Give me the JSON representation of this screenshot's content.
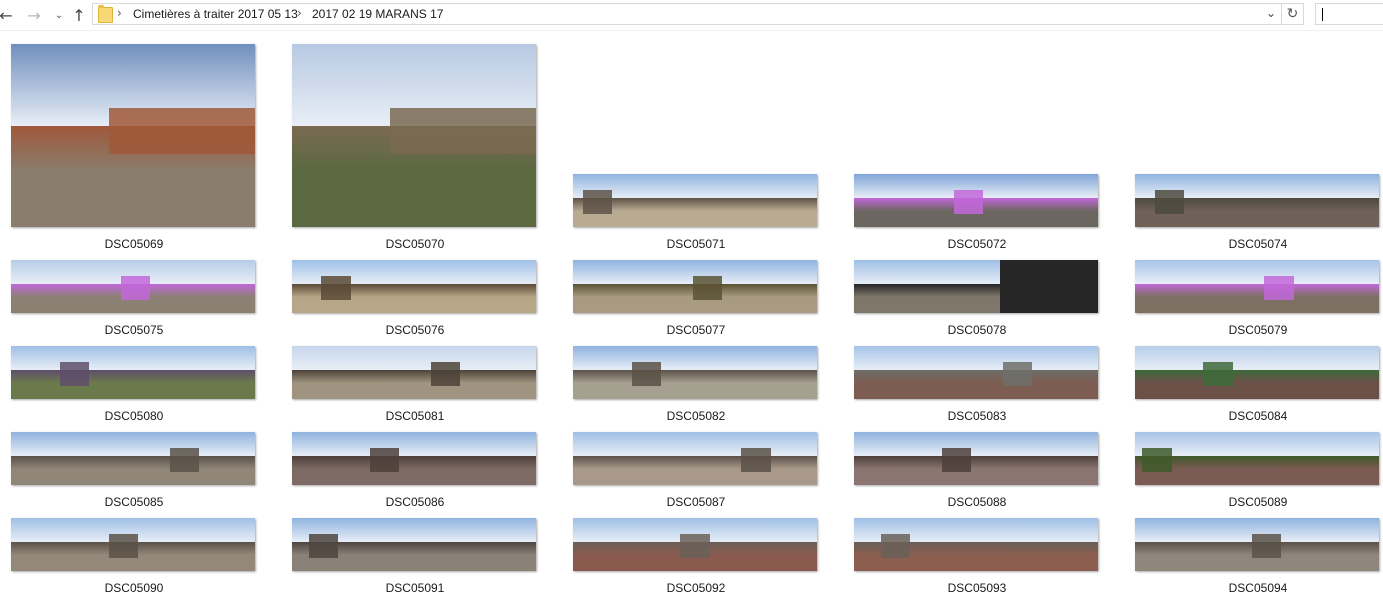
{
  "toolbar": {
    "back_icon": "arrow-left-icon",
    "forward_icon": "arrow-right-icon",
    "recent_icon": "chevron-down-icon",
    "up_icon": "arrow-up-icon",
    "refresh_icon": "refresh-icon",
    "search_value": ""
  },
  "breadcrumb": [
    "Cimetières à traiter 2017 05 13",
    "2017 02 19 MARANS 17"
  ],
  "files": [
    {
      "name": "DSC05069",
      "shape": "tall",
      "sky": "#6f8fbd",
      "ground": "#8a7d6e",
      "mark": "#a0583a"
    },
    {
      "name": "DSC05070",
      "shape": "tall",
      "sky": "#b7c9e2",
      "ground": "#5b6940",
      "mark": "#7a6a52"
    },
    {
      "name": "DSC05071",
      "shape": "pano",
      "sky": "#8fb3e0",
      "ground": "#b9aa92",
      "mark": "#5d5246"
    },
    {
      "name": "DSC05072",
      "shape": "pano",
      "sky": "#7fa6d8",
      "ground": "#6c6660",
      "mark": "#c267d9"
    },
    {
      "name": "DSC05074",
      "shape": "pano",
      "sky": "#8fb3e0",
      "ground": "#6f6158",
      "mark": "#4d4a3e"
    },
    {
      "name": "DSC05075",
      "shape": "pano",
      "sky": "#b7cde8",
      "ground": "#8a8173",
      "mark": "#c267d9"
    },
    {
      "name": "DSC05076",
      "shape": "pano",
      "sky": "#9fc0e8",
      "ground": "#b8a688",
      "mark": "#5a4a36"
    },
    {
      "name": "DSC05077",
      "shape": "pano",
      "sky": "#8fb3e0",
      "ground": "#a99a82",
      "mark": "#5b5234"
    },
    {
      "name": "DSC05078",
      "shape": "pano",
      "sky": "#9fbfe6",
      "ground": "#7f786a",
      "mark": "#262626"
    },
    {
      "name": "DSC05079",
      "shape": "pano",
      "sky": "#a7c4e8",
      "ground": "#7d7062",
      "mark": "#c267d9"
    },
    {
      "name": "DSC05080",
      "shape": "pano",
      "sky": "#9fbfe6",
      "ground": "#6b7a4a",
      "mark": "#5e4e6a"
    },
    {
      "name": "DSC05081",
      "shape": "pano",
      "sky": "#c6d6ec",
      "ground": "#a09480",
      "mark": "#4c4338"
    },
    {
      "name": "DSC05082",
      "shape": "pano",
      "sky": "#8fb3e0",
      "ground": "#a6a090",
      "mark": "#5a5148"
    },
    {
      "name": "DSC05083",
      "shape": "pano",
      "sky": "#a7c4e8",
      "ground": "#7d5c52",
      "mark": "#6e6e68"
    },
    {
      "name": "DSC05084",
      "shape": "pano",
      "sky": "#b7cde8",
      "ground": "#6b5048",
      "mark": "#3e6a3a"
    },
    {
      "name": "DSC05085",
      "shape": "pano",
      "sky": "#8fb3e0",
      "ground": "#8f8678",
      "mark": "#5a5148"
    },
    {
      "name": "DSC05086",
      "shape": "pano",
      "sky": "#8fb3e0",
      "ground": "#7e6a64",
      "mark": "#4d3f3a"
    },
    {
      "name": "DSC05087",
      "shape": "pano",
      "sky": "#9fbfe6",
      "ground": "#a9998a",
      "mark": "#5a5148"
    },
    {
      "name": "DSC05088",
      "shape": "pano",
      "sky": "#8fb3e0",
      "ground": "#8a7570",
      "mark": "#4d3f3a"
    },
    {
      "name": "DSC05089",
      "shape": "pano",
      "sky": "#a7c4e8",
      "ground": "#7a5a52",
      "mark": "#3f5a2a"
    },
    {
      "name": "DSC05090",
      "shape": "pano",
      "sky": "#9fbfe6",
      "ground": "#938879",
      "mark": "#5a5148"
    },
    {
      "name": "DSC05091",
      "shape": "pano",
      "sky": "#8fb3e0",
      "ground": "#8a8177",
      "mark": "#4d4540"
    },
    {
      "name": "DSC05092",
      "shape": "pano",
      "sky": "#9fbfe6",
      "ground": "#8b5a4e",
      "mark": "#6a6058"
    },
    {
      "name": "DSC05093",
      "shape": "pano",
      "sky": "#9fbfe6",
      "ground": "#8b5e50",
      "mark": "#6a6058"
    },
    {
      "name": "DSC05094",
      "shape": "pano",
      "sky": "#8fb3e0",
      "ground": "#8f877c",
      "mark": "#5a5148"
    }
  ]
}
